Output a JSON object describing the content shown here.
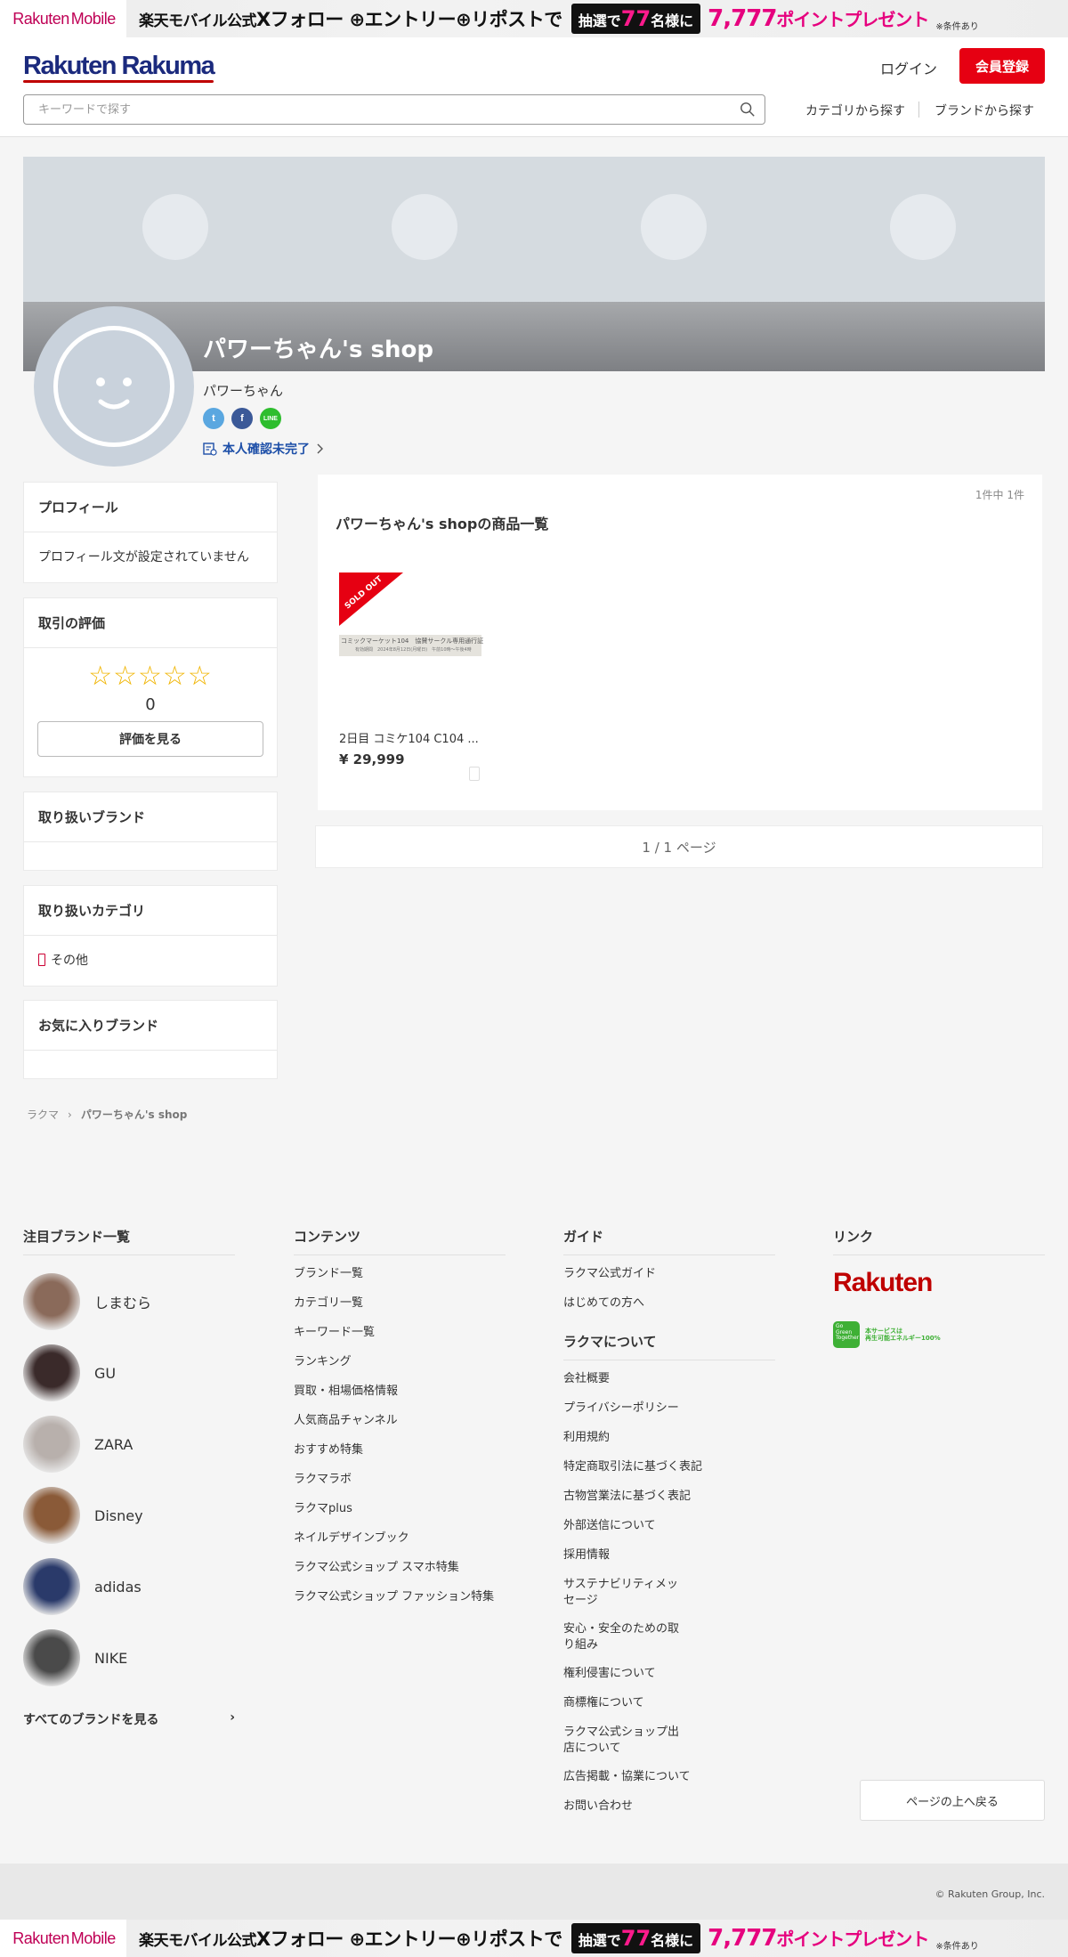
{
  "promo": {
    "brand": "Rakuten",
    "brand_suffix": "Mobile",
    "text_prefix": "楽天モバイル公式",
    "text_main": "Xフォロー",
    "plus1": "⊕",
    "entry": "エントリー",
    "plus2": "⊕",
    "repost": "リポストで",
    "lotto_prefix": "抽選で",
    "lotto_num": "77",
    "lotto_suffix": "名様に",
    "points_num": "7,777",
    "points_text": "ポイントプレゼント",
    "condition": "※条件あり",
    "accent_color": "#e6007e"
  },
  "header": {
    "logo": "Rakuten Rakuma",
    "login": "ログイン",
    "register": "会員登録",
    "search_placeholder": "キーワードで探す",
    "nav_category": "カテゴリから探す",
    "nav_brand": "ブランドから探す",
    "accent_color": "#e60012"
  },
  "shop": {
    "name": "パワーちゃん's shop",
    "owner": "パワーちゃん",
    "social": {
      "twitter": "t",
      "facebook": "f",
      "line": "LINE"
    },
    "verification": "本人確認未完了"
  },
  "sidebar": {
    "profile": {
      "title": "プロフィール",
      "text": "プロフィール文が設定されていません"
    },
    "rating": {
      "title": "取引の評価",
      "stars": "☆☆☆☆☆",
      "count": "0",
      "button": "評価を見る"
    },
    "brands": {
      "title": "取り扱いブランド"
    },
    "categories": {
      "title": "取り扱いカテゴリ",
      "item": "その他"
    },
    "favorite_brands": {
      "title": "お気に入りブランド"
    }
  },
  "main": {
    "count": "1件中 1件",
    "title": "パワーちゃん's shopの商品一覧",
    "products": [
      {
        "name": "2日目 コミケ104 C104 ...",
        "price": "¥ 29,999",
        "sold_out": "SOLD OUT",
        "ticket_line1": "コミックマーケット104　協賛サークル専用通行証",
        "ticket_line2": "有効期間　2024年8月12日(月曜日)　午前10時～午後4時"
      }
    ],
    "pager": "1 / 1 ページ"
  },
  "breadcrumb": {
    "home": "ラクマ",
    "separator": "›",
    "current": "パワーちゃん's shop"
  },
  "footer": {
    "brands_title": "注目ブランド一覧",
    "brands": [
      {
        "name": "しまむら",
        "color": "#8a6a5a"
      },
      {
        "name": "GU",
        "color": "#3a2a2a"
      },
      {
        "name": "ZARA",
        "color": "#b8b0ac"
      },
      {
        "name": "Disney",
        "color": "#8a5a38"
      },
      {
        "name": "adidas",
        "color": "#2a3a6a"
      },
      {
        "name": "NIKE",
        "color": "#4a4a4a"
      }
    ],
    "all_brands": "すべてのブランドを見る",
    "all_brands_arrow": "›",
    "contents_title": "コンテンツ",
    "contents": [
      "ブランド一覧",
      "カテゴリ一覧",
      "キーワード一覧",
      "ランキング",
      "買取・相場価格情報",
      "人気商品チャンネル",
      "おすすめ特集",
      "ラクマラボ",
      "ラクマplus",
      "ネイルデザインブック",
      "ラクマ公式ショップ スマホ特集",
      "ラクマ公式ショップ ファッション特集"
    ],
    "guide_title": "ガイド",
    "guide": [
      "ラクマ公式ガイド",
      "はじめての方へ"
    ],
    "about_title": "ラクマについて",
    "about": [
      "会社概要",
      "プライバシーポリシー",
      "利用規約",
      "特定商取引法に基づく表記",
      "古物営業法に基づく表記",
      "外部送信について",
      "採用情報",
      "サステナビリティメッセージ",
      "安心・安全のための取り組み",
      "権利侵害について",
      "商標権について",
      "ラクマ公式ショップ出店について",
      "広告掲載・協業について",
      "お問い合わせ"
    ],
    "links_title": "リンク",
    "rakuten_logo": "Rakuten",
    "eco_badge": "Go Green Together",
    "eco_line1": "本サービスは",
    "eco_line2": "再生可能エネルギー100%",
    "back_to_top": "ページの上へ戻る",
    "copyright": "© Rakuten Group, Inc."
  }
}
